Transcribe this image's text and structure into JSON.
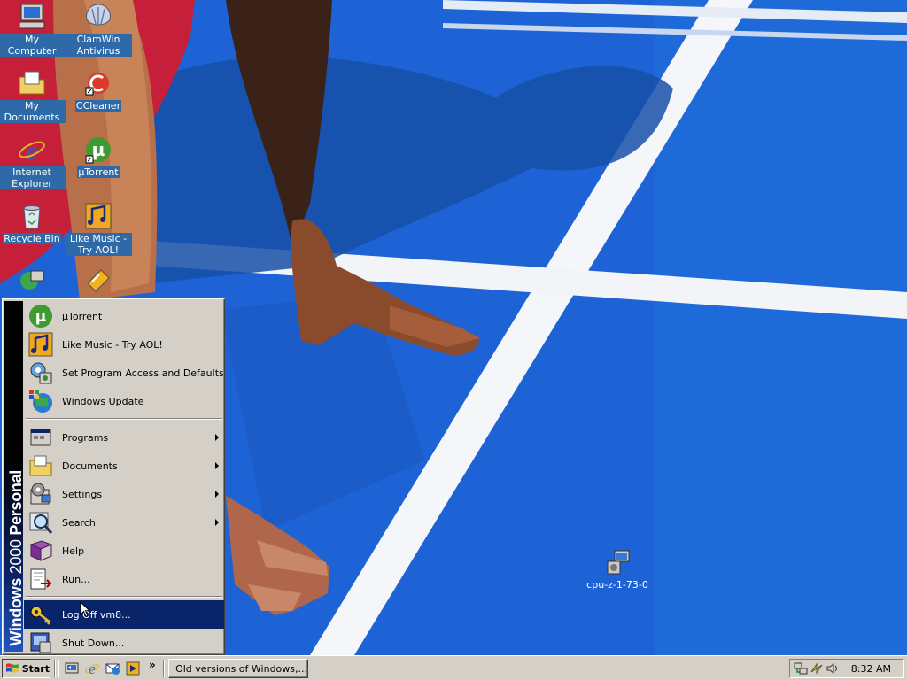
{
  "desktop": {
    "icons": [
      {
        "label": "My Computer",
        "icon": "my-computer-icon"
      },
      {
        "label": "ClamWin Antivirus",
        "icon": "clamwin-icon"
      },
      {
        "label": "My Documents",
        "icon": "my-documents-icon"
      },
      {
        "label": "CCleaner",
        "icon": "ccleaner-icon"
      },
      {
        "label": "Internet Explorer",
        "icon": "internet-explorer-icon"
      },
      {
        "label": "µTorrent",
        "icon": "utorrent-icon"
      },
      {
        "label": "Recycle Bin",
        "icon": "recycle-bin-icon"
      },
      {
        "label": "Like Music - Try AOL!",
        "icon": "aol-music-icon"
      },
      {
        "label": "cpu-z-1-73-0",
        "icon": "installer-icon"
      }
    ]
  },
  "start_menu": {
    "banner": {
      "brand": "Windows",
      "version": "2000",
      "edition": "Personal"
    },
    "pinned": [
      {
        "label": "µTorrent",
        "icon": "utorrent-icon"
      },
      {
        "label": "Like Music - Try AOL!",
        "icon": "aol-music-icon"
      },
      {
        "label": "Set Program Access and Defaults",
        "icon": "program-defaults-icon"
      },
      {
        "label": "Windows Update",
        "icon": "windows-update-icon"
      }
    ],
    "items": [
      {
        "label": "Programs",
        "icon": "programs-icon",
        "submenu": true
      },
      {
        "label": "Documents",
        "icon": "documents-folder-icon",
        "submenu": true
      },
      {
        "label": "Settings",
        "icon": "settings-icon",
        "submenu": true
      },
      {
        "label": "Search",
        "icon": "search-icon",
        "submenu": true
      },
      {
        "label": "Help",
        "icon": "help-book-icon",
        "submenu": false
      },
      {
        "label": "Run...",
        "icon": "run-icon",
        "submenu": false
      }
    ],
    "bottom": [
      {
        "label": "Log Off vm8...",
        "icon": "log-off-key-icon",
        "selected": true
      },
      {
        "label": "Shut Down...",
        "icon": "shut-down-icon",
        "selected": false
      }
    ]
  },
  "taskbar": {
    "start_label": "Start",
    "quick_launch": [
      "show-desktop-icon",
      "internet-explorer-icon",
      "outlook-express-icon",
      "media-player-icon"
    ],
    "overflow": "»",
    "task_button": {
      "label": "Old versions of Windows,...",
      "icon": "opera-icon"
    },
    "tray_icons": [
      "network-icon",
      "power-icon",
      "volume-icon"
    ],
    "clock": "8:32 AM"
  },
  "colors": {
    "menu_face": "#d4d0c8",
    "selection": "#0a246a",
    "track_blue": "#1d63d6"
  }
}
